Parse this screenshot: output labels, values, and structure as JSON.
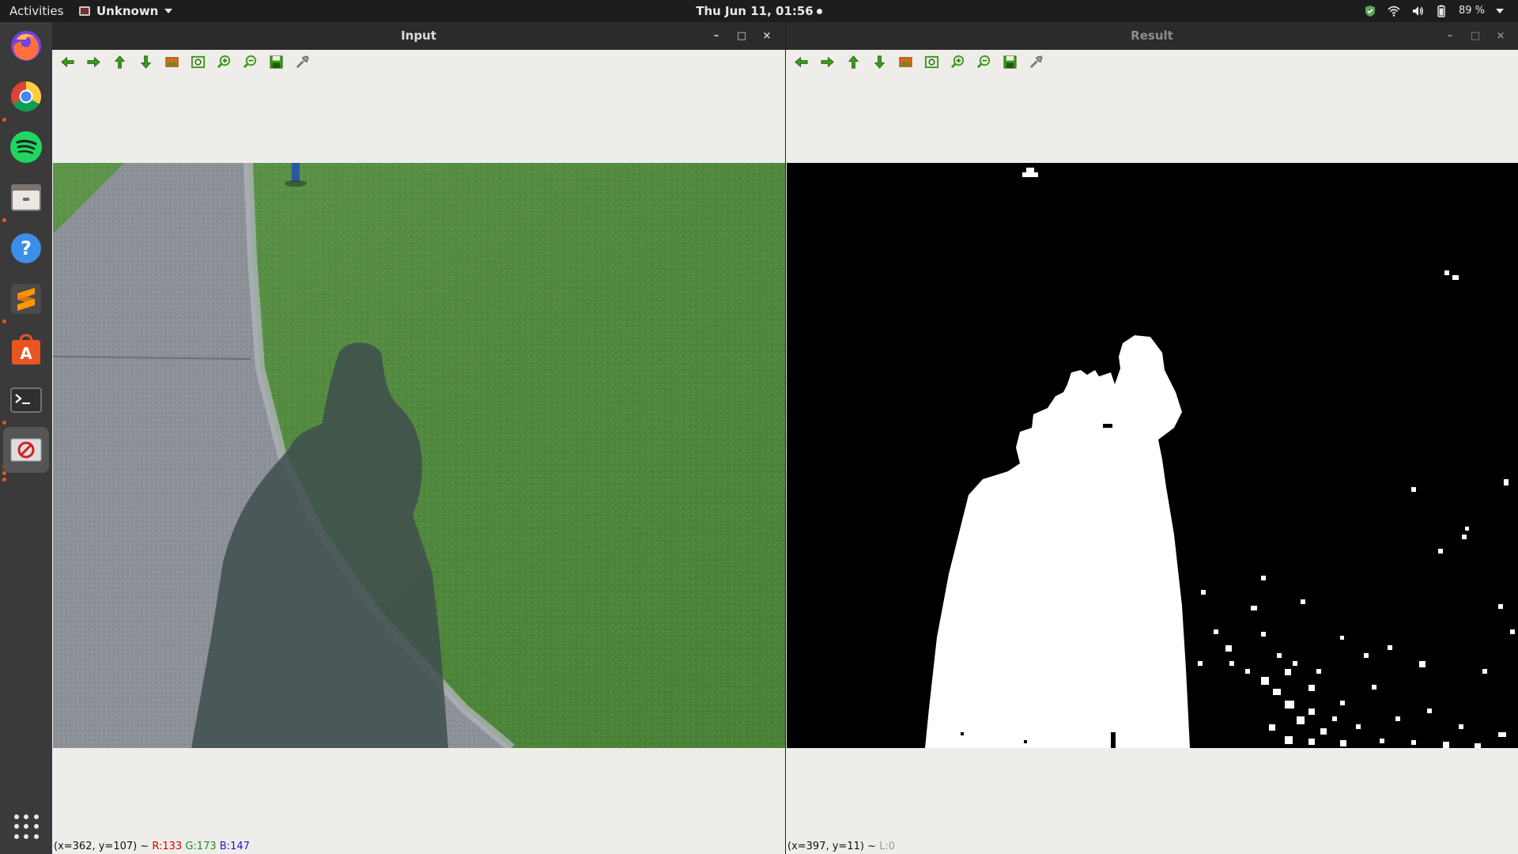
{
  "topbar": {
    "activities": "Activities",
    "app_name": "Unknown",
    "clock": "Thu Jun 11, 01:56",
    "battery": "89 %"
  },
  "dock": {
    "items": [
      {
        "name": "firefox-icon",
        "running": false
      },
      {
        "name": "chrome-icon",
        "running": true
      },
      {
        "name": "spotify-icon",
        "running": false
      },
      {
        "name": "files-icon",
        "running": true
      },
      {
        "name": "help-icon",
        "running": false
      },
      {
        "name": "sublime-text-icon",
        "running": true
      },
      {
        "name": "software-center-icon",
        "running": false
      },
      {
        "name": "terminal-icon",
        "running": true
      },
      {
        "name": "opencv-window-icon",
        "running": true
      }
    ]
  },
  "windows": {
    "input": {
      "title": "Input",
      "status": {
        "coords": "(x=362, y=107) ~",
        "r": "R:133",
        "g": "G:173",
        "b": "B:147"
      }
    },
    "result": {
      "title": "Result",
      "status": {
        "coords": "(x=397, y=11) ~",
        "l": "L:0"
      }
    }
  },
  "toolbar": {
    "buttons": [
      "pan-left-icon",
      "pan-right-icon",
      "pan-up-icon",
      "pan-down-icon",
      "zoom-original-icon",
      "zoom-fit-icon",
      "zoom-in-icon",
      "zoom-out-icon",
      "save-icon",
      "properties-icon"
    ]
  },
  "colors": {
    "grass": "#4f8a3a",
    "path": "#8a8f96",
    "shadow": "#3f4d4e",
    "accent_dot": "#e95420"
  }
}
